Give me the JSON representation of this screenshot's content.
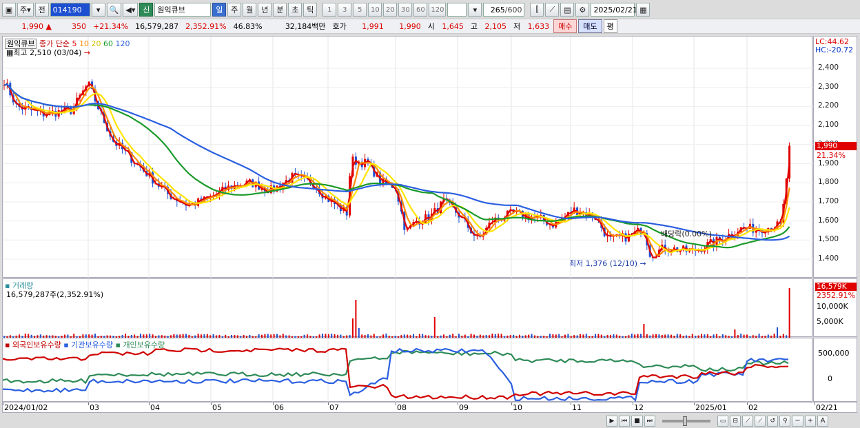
{
  "toolbar": {
    "market_btn": "주",
    "prev_btn": "전",
    "code": "014190",
    "badge": "신",
    "stock_name": "원익큐브",
    "periods": [
      "일",
      "주",
      "월",
      "년",
      "분",
      "초",
      "틱"
    ],
    "active_period": "일",
    "intervals": [
      "1",
      "3",
      "5",
      "10",
      "20",
      "30",
      "60",
      "120"
    ],
    "count": "265",
    "count_max": "/600",
    "date": "2025/02/21"
  },
  "quote": {
    "price": "1,990",
    "change": "350",
    "change_pct": "+21.34%",
    "volume": "16,579,287",
    "volume_pct": "2,352.91%",
    "turnover": "46.83%",
    "amount": "32,184백만",
    "bid_label": "호가",
    "ask": "1,991",
    "bid": "1,990",
    "open_label": "시",
    "open": "1,645",
    "high_label": "고",
    "high": "2,105",
    "low_label": "저",
    "low": "1,633",
    "buy_btn": "매수",
    "sell_btn": "매도",
    "even_btn": "평"
  },
  "price_panel": {
    "stock_name": "원익큐브",
    "ma_label": "종가 단순",
    "ma_periods": [
      "5",
      "10",
      "20",
      "60",
      "120"
    ],
    "ma_colors": [
      "#e00000",
      "#ff8c00",
      "#ffe400",
      "#1a9a2a",
      "#2a5fe0"
    ],
    "high_note": "최고 2,510 (03/04)",
    "low_note": "최저 1,376 (12/10)",
    "div_note": "배당락(0.00%)",
    "lc": "LC:44.62",
    "hc": "HC:-20.72",
    "y_ticks": [
      "2,400",
      "2,300",
      "2,200",
      "2,100",
      "2,000",
      "1,900",
      "1,800",
      "1,700",
      "1,600",
      "1,500",
      "1,400"
    ],
    "cur_price": "1,990",
    "cur_pct": "21.34%"
  },
  "volume_panel": {
    "title": "거래량",
    "value": "16,579,287주(2,352.91%)",
    "cur": "16,579K",
    "cur_pct": "2352.91%",
    "y_ticks": [
      "10,000K",
      "5,000K"
    ]
  },
  "holdings_panel": {
    "series": [
      "외국인보유수량",
      "기관보유수량",
      "개인보유수량"
    ],
    "series_colors": [
      "#d00000",
      "#2a5fe0",
      "#2e8b57"
    ],
    "y_ticks": [
      "500,000",
      "0"
    ]
  },
  "x_axis": {
    "labels": [
      "2024/01/02",
      "03",
      "04",
      "05",
      "06",
      "07",
      "08",
      "09",
      "10",
      "11",
      "12",
      "2025/01",
      "02",
      "02/21"
    ]
  }
}
